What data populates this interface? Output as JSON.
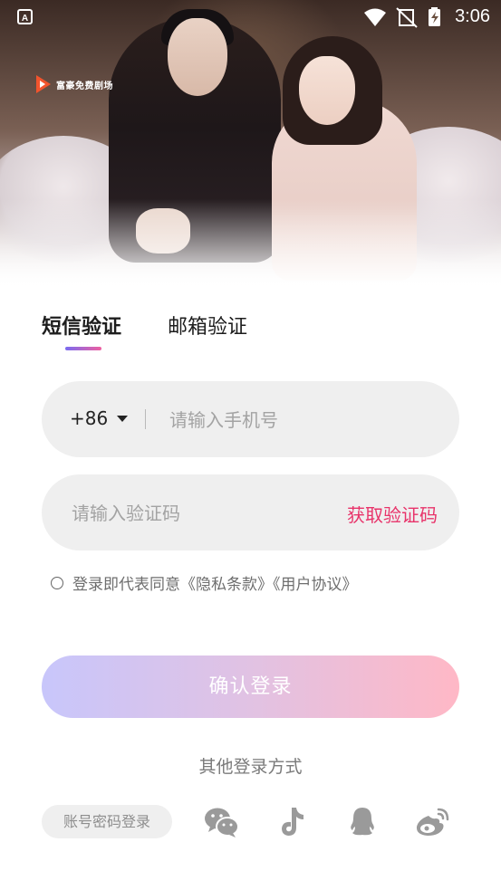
{
  "status_bar": {
    "time": "3:06",
    "app_icon": "A"
  },
  "banner": {
    "brand_name": "富豪免费剧场"
  },
  "tabs": [
    {
      "label": "短信验证",
      "active": true
    },
    {
      "label": "邮箱验证",
      "active": false
    }
  ],
  "phone": {
    "country_code": "+86",
    "placeholder": "请输入手机号",
    "value": ""
  },
  "code": {
    "placeholder": "请输入验证码",
    "value": "",
    "get_code_label": "获取验证码"
  },
  "agreement": {
    "checked": false,
    "prefix": "登录即代表同意",
    "privacy_link": "《隐私条款》",
    "user_link": "《用户协议》"
  },
  "confirm_label": "确认登录",
  "other_login": {
    "title": "其他登录方式",
    "account_button": "账号密码登录",
    "icons": [
      "wechat-icon",
      "tiktok-icon",
      "qq-icon",
      "weibo-icon"
    ]
  },
  "colors": {
    "accent_pink": "#e8336a",
    "tab_gradient_start": "#7a6cf0",
    "tab_gradient_end": "#ee5fa0",
    "button_gradient_start": "#c8c6fb",
    "button_gradient_end": "#ffb8c6",
    "icon_gray": "#9a9a9a"
  }
}
